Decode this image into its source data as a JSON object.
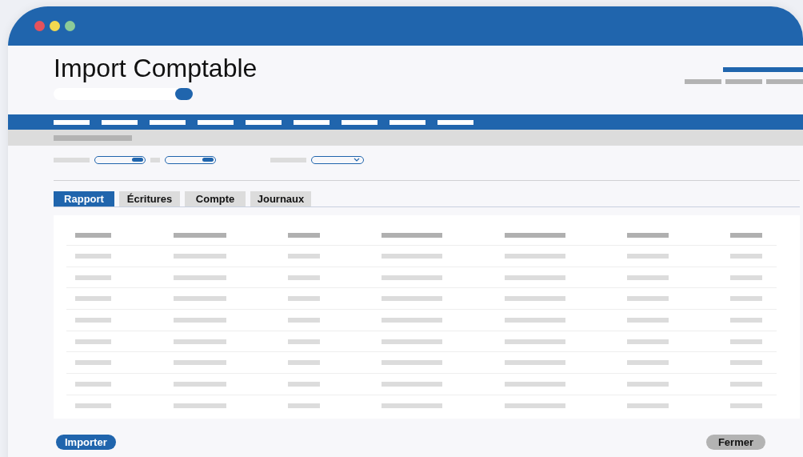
{
  "window": {
    "title": "Import Comptable"
  },
  "tabs": [
    {
      "label": "Rapport",
      "selected": true
    },
    {
      "label": "Écritures",
      "selected": false
    },
    {
      "label": "Compte",
      "selected": false
    },
    {
      "label": "Journaux",
      "selected": false
    }
  ],
  "buttons": [
    {
      "label": "Importer",
      "kind": "primary"
    },
    {
      "label": "Fermer",
      "kind": "secondary"
    }
  ]
}
